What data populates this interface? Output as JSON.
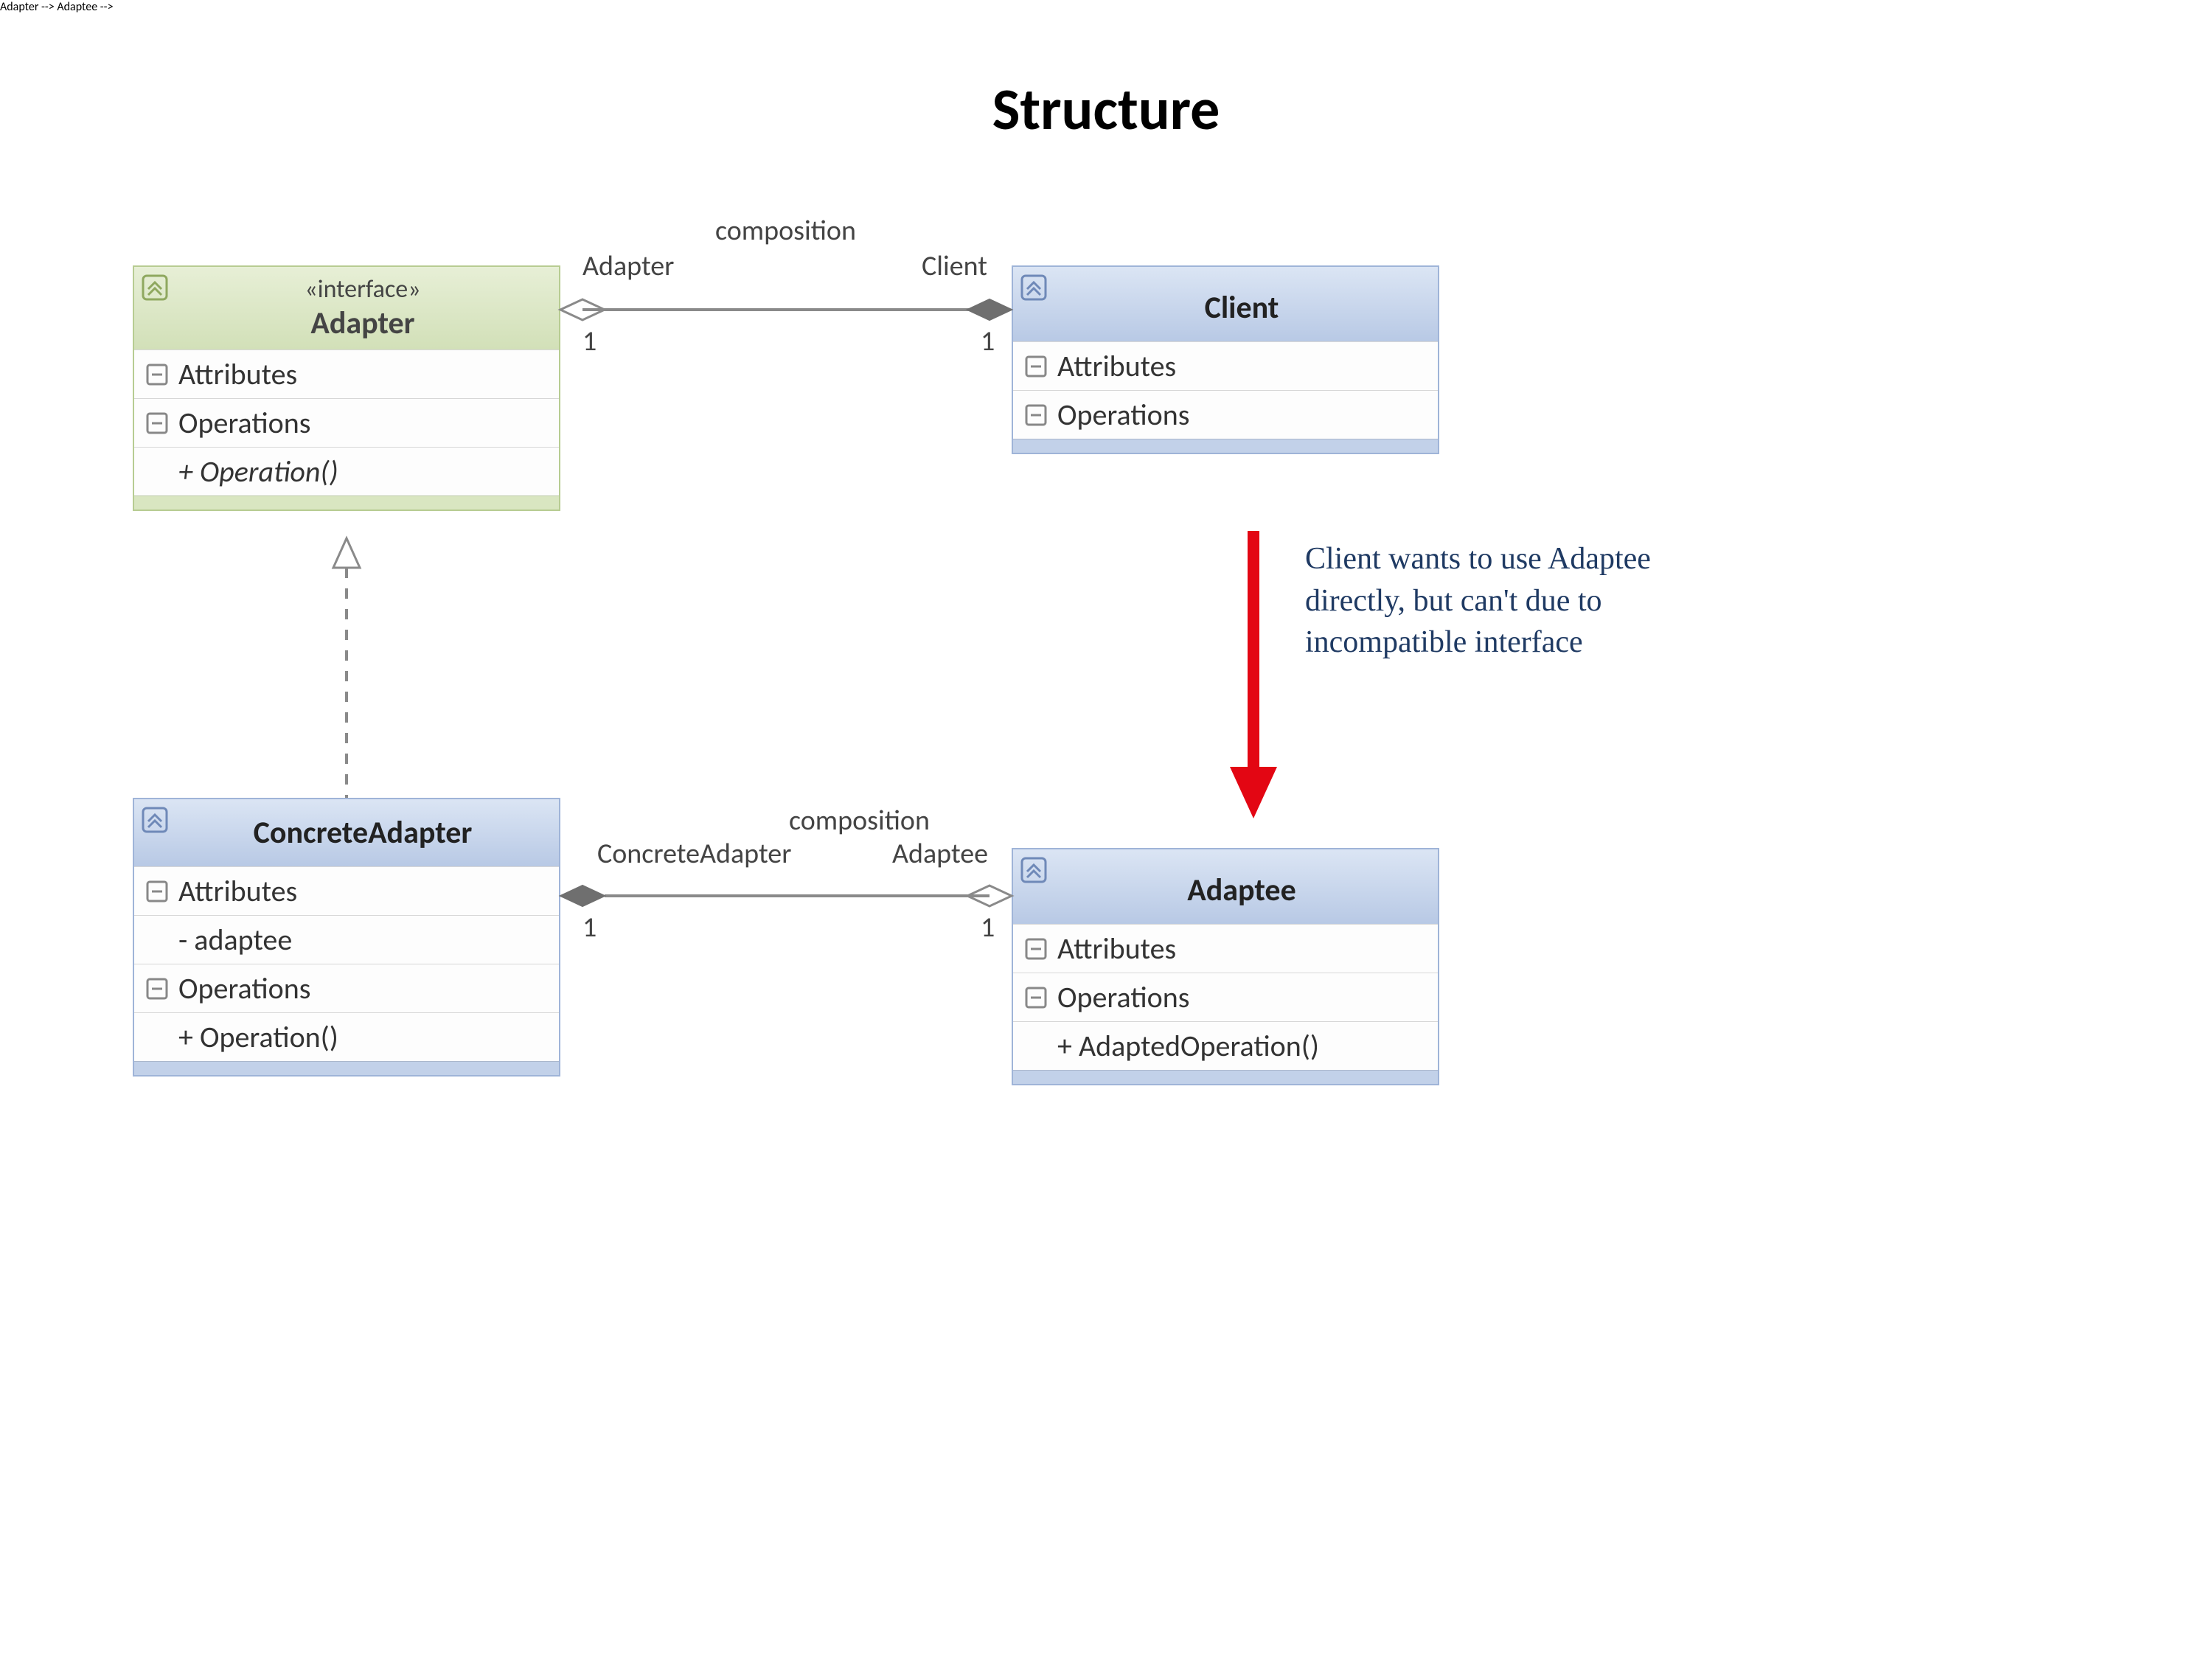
{
  "title": "Structure",
  "classes": {
    "adapter": {
      "stereotype": "«interface»",
      "name": "Adapter",
      "sections": {
        "attributes": "Attributes",
        "operations": "Operations",
        "operation_item": "+ Operation()"
      }
    },
    "client": {
      "name": "Client",
      "sections": {
        "attributes": "Attributes",
        "operations": "Operations"
      }
    },
    "concrete_adapter": {
      "name": "ConcreteAdapter",
      "sections": {
        "attributes": "Attributes",
        "attr_item": "- adaptee",
        "operations": "Operations",
        "op_item": "+ Operation()"
      }
    },
    "adaptee": {
      "name": "Adaptee",
      "sections": {
        "attributes": "Attributes",
        "operations": "Operations",
        "op_item": "+ AdaptedOperation()"
      }
    }
  },
  "connectors": {
    "client_to_adapter": {
      "label_mid": "composition",
      "end1_role": "Adapter",
      "end1_mult": "1",
      "end2_role": "Client",
      "end2_mult": "1"
    },
    "concrete_to_adaptee": {
      "label_mid": "composition",
      "end1_role": "ConcreteAdapter",
      "end1_mult": "1",
      "end2_role": "Adaptee",
      "end2_mult": "1"
    }
  },
  "annotation": "Client wants to use Adaptee directly, but can't due to incompatible interface"
}
